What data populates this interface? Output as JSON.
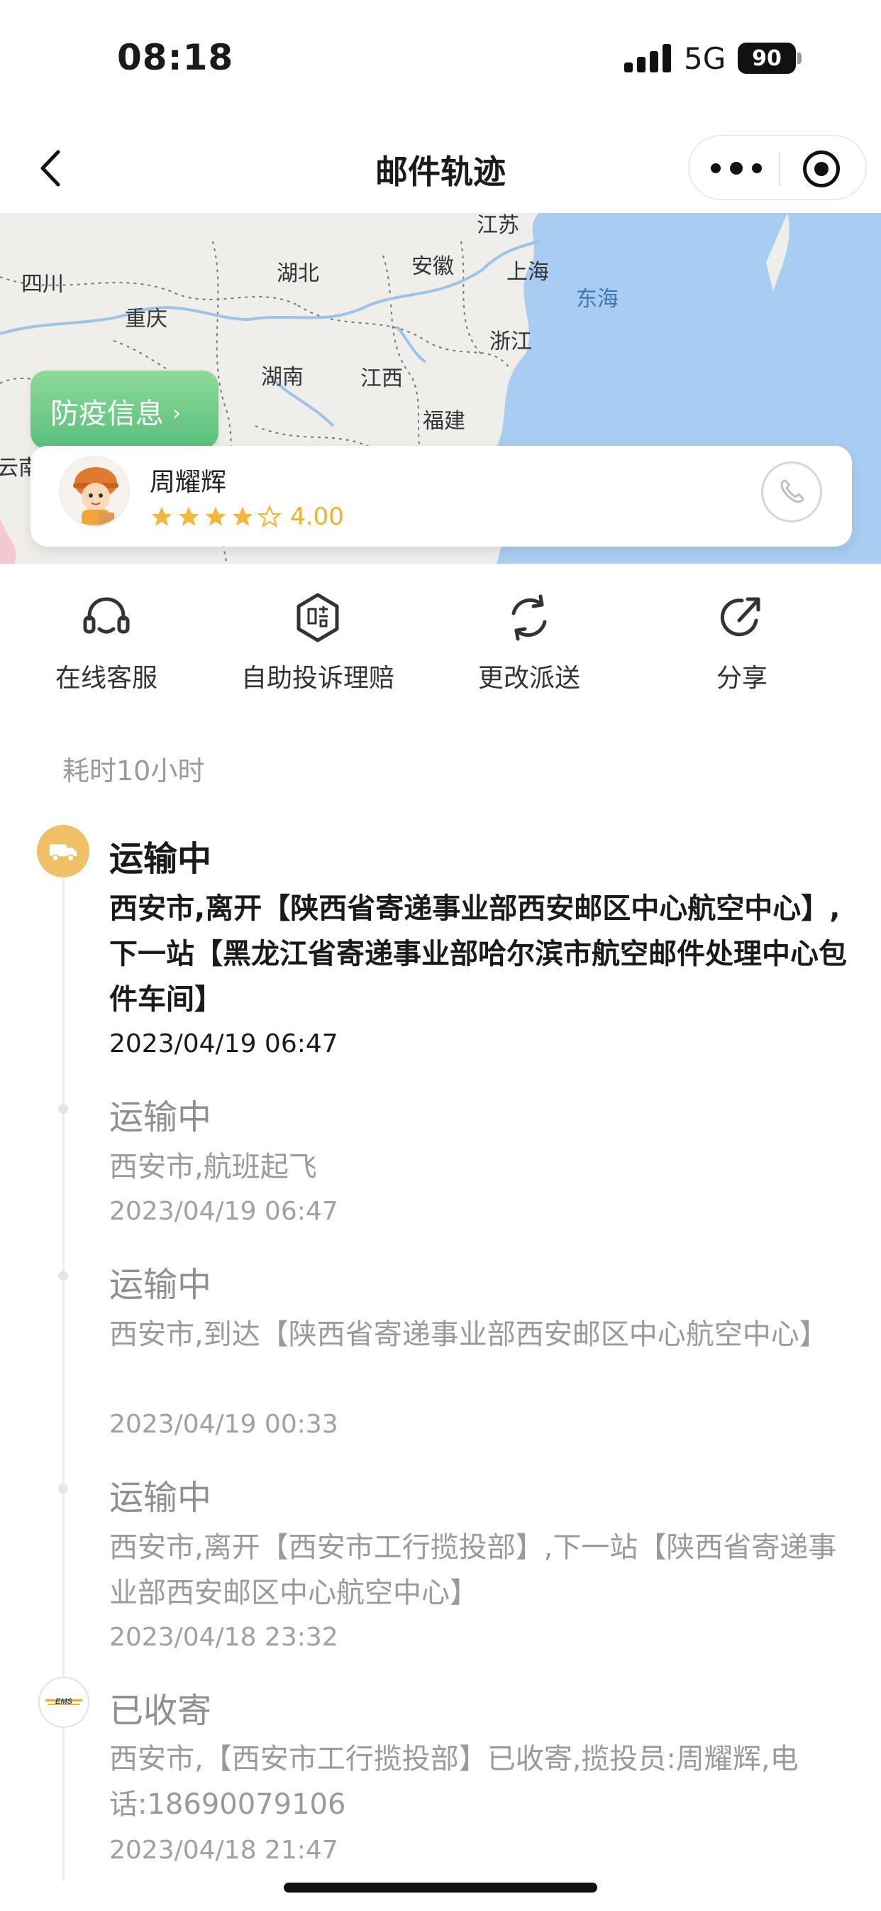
{
  "status_bar": {
    "time": "08:18",
    "network": "5G",
    "battery": "90"
  },
  "nav": {
    "title": "邮件轨迹"
  },
  "map": {
    "labels": [
      "四川",
      "湖北",
      "安徽",
      "江苏",
      "上海",
      "东海",
      "重庆",
      "浙江",
      "湖南",
      "江西",
      "福建",
      "云南"
    ]
  },
  "epidemic": {
    "label": "防疫信息",
    "chevron": "›"
  },
  "courier": {
    "name": "周耀辉",
    "rating": "4.00",
    "stars_filled": 4,
    "stars_total": 5
  },
  "actions": [
    {
      "label": "在线客服",
      "icon": "headset-icon"
    },
    {
      "label": "自助投诉理赔",
      "icon": "compensation-icon"
    },
    {
      "label": "更改派送",
      "icon": "refresh-icon"
    },
    {
      "label": "分享",
      "icon": "share-icon"
    }
  ],
  "duration": "耗时10小时",
  "timeline": [
    {
      "status": "运输中",
      "desc": "西安市,离开【陕西省寄递事业部西安邮区中心航空中心】,下一站【黑龙江省寄递事业部哈尔滨市航空邮件处理中心包件车间】",
      "time": "2023/04/19 06:47"
    },
    {
      "status": "运输中",
      "desc": "西安市,航班起飞",
      "time": "2023/04/19 06:47"
    },
    {
      "status": "运输中",
      "desc": "西安市,到达【陕西省寄递事业部西安邮区中心航空中心】",
      "time": "2023/04/19 00:33"
    },
    {
      "status": "运输中",
      "desc": "西安市,离开【西安市工行揽投部】,下一站【陕西省寄递事业部西安邮区中心航空中心】",
      "time": "2023/04/18 23:32"
    },
    {
      "status": "已收寄",
      "desc": "西安市,【西安市工行揽投部】已收寄,揽投员:周耀辉,电话:18690079106",
      "time": "2023/04/18 21:47"
    }
  ],
  "ems_badge_text": "EMS"
}
